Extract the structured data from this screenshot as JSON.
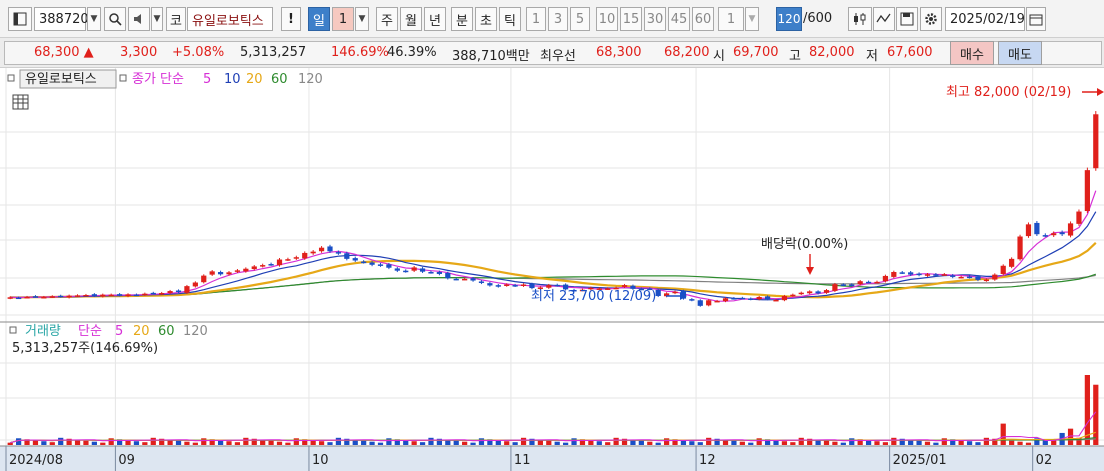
{
  "toolbar": {
    "code": "388720",
    "market_badge": "코",
    "stock_name": "유일로보틱스",
    "period_daily": "일",
    "period_count": "1",
    "period_week": "주",
    "period_month": "월",
    "period_year": "년",
    "period_minute": "분",
    "period_second": "초",
    "period_tick": "틱",
    "intervals": [
      "1",
      "3",
      "5",
      "10",
      "15",
      "30",
      "45",
      "60"
    ],
    "interval_select": "1",
    "bars_shown": "120",
    "bars_total": "/600",
    "date": "2025/02/19"
  },
  "quote": {
    "price": "68,300",
    "change": "3,300",
    "change_pct": "+5.08%",
    "volume": "5,313,257",
    "volume_ratio": "146.69%",
    "turnover_pct": "46.39%",
    "amount": "388,710백만",
    "best_label": "최우선",
    "best_ask": "68,300",
    "best_bid": "68,200",
    "open_label": "시",
    "open": "69,700",
    "high_label": "고",
    "high": "82,000",
    "low_label": "저",
    "low": "67,600",
    "buy_label": "매수",
    "sell_label": "매도"
  },
  "colors": {
    "up": "#e0201b",
    "down": "#1a4fc6",
    "ma5": "#d62fd6",
    "ma10": "#1f3fb5",
    "ma20": "#e6a817",
    "ma60": "#2e8b2e",
    "ma120": "#808080"
  },
  "chart_data": [
    {
      "type": "candlestick",
      "legend": {
        "name": "유일로보틱스",
        "prefix": "종가 단순",
        "periods": [
          "5",
          "10",
          "20",
          "60",
          "120"
        ]
      },
      "annotations": {
        "high": "최고 82,000 (02/19)",
        "low": "최저 23,700 (12/09)",
        "event": "배당락(0.00%)"
      },
      "x_ticks": [
        "2024/08",
        "09",
        "10",
        "11",
        "12",
        "2025/01",
        "02"
      ],
      "ylim": [
        20000,
        90000
      ],
      "series_close": [
        26300,
        26200,
        26400,
        26500,
        26400,
        26600,
        26500,
        26800,
        26900,
        27000,
        26700,
        27100,
        27100,
        26900,
        27200,
        27000,
        27400,
        27500,
        27600,
        28200,
        27900,
        29700,
        30800,
        32900,
        34200,
        33300,
        33900,
        34500,
        35000,
        35700,
        36100,
        36300,
        37800,
        37900,
        38500,
        39800,
        40200,
        41400,
        40300,
        39700,
        38000,
        37500,
        37000,
        36200,
        36000,
        35300,
        34400,
        34200,
        35400,
        34100,
        33900,
        33400,
        32100,
        31900,
        31900,
        31400,
        30700,
        29900,
        29600,
        30200,
        29800,
        30200,
        29100,
        29300,
        30000,
        29900,
        28700,
        28500,
        28600,
        29200,
        29000,
        29000,
        29200,
        30000,
        28900,
        28800,
        28800,
        26700,
        27500,
        28000,
        25900,
        25400,
        23700,
        25400,
        25200,
        26000,
        25900,
        26100,
        25700,
        26400,
        25700,
        25500,
        26700,
        27100,
        27700,
        28100,
        27500,
        28500,
        30300,
        30100,
        30000,
        31200,
        31000,
        31000,
        32800,
        34000,
        33800,
        33200,
        33100,
        33300,
        33100,
        33300,
        32500,
        32500,
        32400,
        31600,
        31700,
        33200,
        35900,
        38000,
        44800,
        48500,
        45500,
        45200,
        45800,
        45500,
        48800,
        52400,
        65000,
        82000
      ],
      "volume_label": "거래량",
      "volume_prefix": "단순",
      "volume_periods": [
        "5",
        "20",
        "60",
        "120"
      ],
      "volume_text": "5,313,257주(146.69%)",
      "volume_spikes": [
        {
          "index": 118,
          "value": 1100000
        },
        {
          "index": 125,
          "value": 620000
        },
        {
          "index": 130,
          "value": 5313257
        },
        {
          "index": 128,
          "value": 3600000
        },
        {
          "index": 129,
          "value": 3100000
        },
        {
          "index": 126,
          "value": 840000
        }
      ]
    }
  ]
}
